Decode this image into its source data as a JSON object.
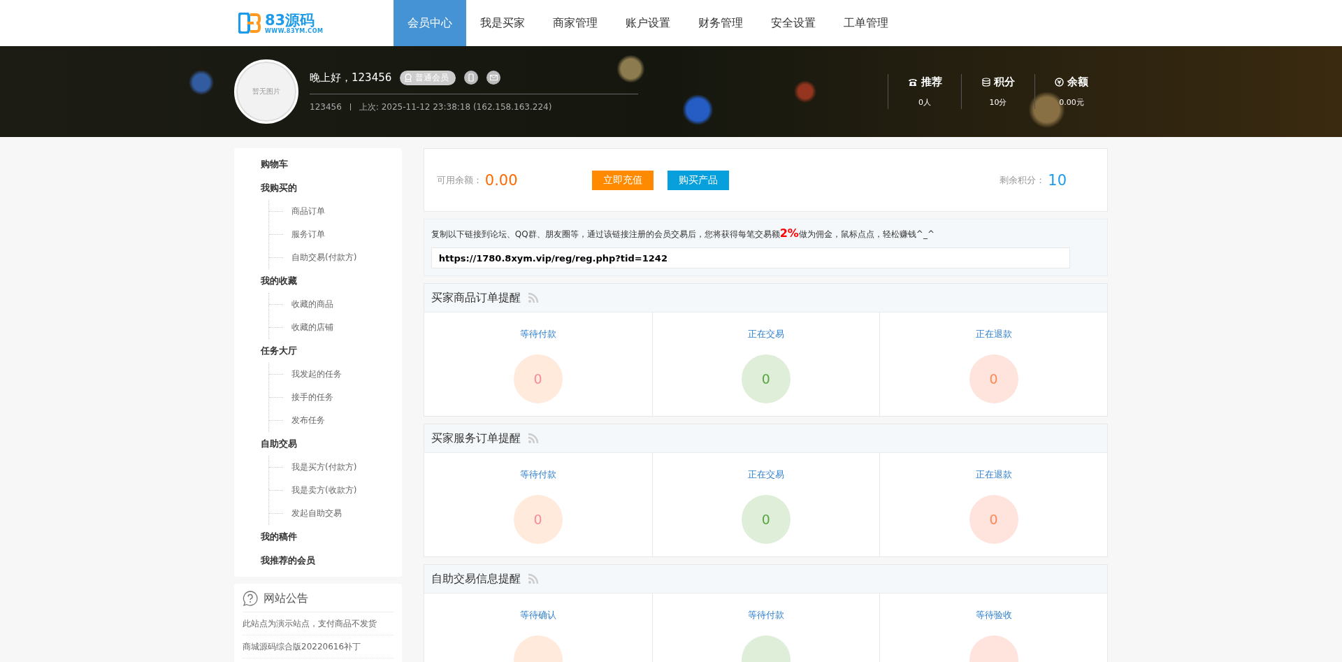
{
  "logo": {
    "name": "83源码",
    "url": "WWW.83YM.COM"
  },
  "nav": [
    {
      "label": "会员中心",
      "selected": true
    },
    {
      "label": "我是买家",
      "selected": false
    },
    {
      "label": "商家管理",
      "selected": false
    },
    {
      "label": "账户设置",
      "selected": false
    },
    {
      "label": "财务管理",
      "selected": false
    },
    {
      "label": "安全设置",
      "selected": false
    },
    {
      "label": "工单管理",
      "selected": false
    }
  ],
  "profile": {
    "avatar": "暂无图片",
    "greeting": "晚上好，123456",
    "badge": "普通会员",
    "username": "123456",
    "last_login": "上次: 2025-11-12 23:38:18 (162.158.163.224)"
  },
  "stats": [
    {
      "kind": "referral",
      "label": "推荐",
      "value": "0人"
    },
    {
      "kind": "points",
      "label": "积分",
      "value": "10分"
    },
    {
      "kind": "balance",
      "label": "余额",
      "value": "0.00元"
    }
  ],
  "sidebar": [
    {
      "label": "购物车"
    },
    {
      "label": "我购买的",
      "children": [
        {
          "label": "商品订单"
        },
        {
          "label": "服务订单"
        },
        {
          "label": "自助交易(付款方)"
        }
      ]
    },
    {
      "label": "我的收藏",
      "children": [
        {
          "label": "收藏的商品"
        },
        {
          "label": "收藏的店铺"
        }
      ]
    },
    {
      "label": "任务大厅",
      "children": [
        {
          "label": "我发起的任务"
        },
        {
          "label": "接手的任务"
        },
        {
          "label": "发布任务"
        }
      ]
    },
    {
      "label": "自助交易",
      "children": [
        {
          "label": "我是买方(付款方)"
        },
        {
          "label": "我是卖方(收款方)"
        },
        {
          "label": "发起自助交易"
        }
      ]
    },
    {
      "label": "我的稿件"
    },
    {
      "label": "我推荐的会员"
    }
  ],
  "notice": {
    "title": "网站公告",
    "items": [
      "此站点为演示站点，支付商品不发货",
      "商城源码综合版20220616补丁"
    ]
  },
  "balance": {
    "label": "可用余额：",
    "amount": "0.00",
    "buttons": [
      {
        "kind": "recharge",
        "label": "立即充值"
      },
      {
        "kind": "buy",
        "label": "购买产品"
      }
    ],
    "points_label": "剩余积分：",
    "points": "10"
  },
  "referral": {
    "text": "复制以下链接到论坛、QQ群、朋友圈等，通过该链接注册的会员交易后，您将获得每笔交易额**2%**做为佣金，鼠标点点，轻松赚钱^_^",
    "link": "https://1780.8xym.vip/reg/reg.php?tid=1242"
  },
  "panels": [
    {
      "title": "买家商品订单提醒",
      "stats": [
        {
          "kind": "orange",
          "label": "等待付款",
          "value": "0"
        },
        {
          "kind": "green",
          "label": "正在交易",
          "value": "0"
        },
        {
          "kind": "red",
          "label": "正在退款",
          "value": "0"
        }
      ]
    },
    {
      "title": "买家服务订单提醒",
      "stats": [
        {
          "kind": "orange",
          "label": "等待付款",
          "value": "0"
        },
        {
          "kind": "green",
          "label": "正在交易",
          "value": "0"
        },
        {
          "kind": "red",
          "label": "正在退款",
          "value": "0"
        }
      ]
    },
    {
      "title": "自助交易信息提醒",
      "stats": [
        {
          "kind": "orange",
          "label": "等待确认"
        },
        {
          "kind": "green",
          "label": "等待付款"
        },
        {
          "kind": "red",
          "label": "等待验收"
        }
      ]
    }
  ]
}
